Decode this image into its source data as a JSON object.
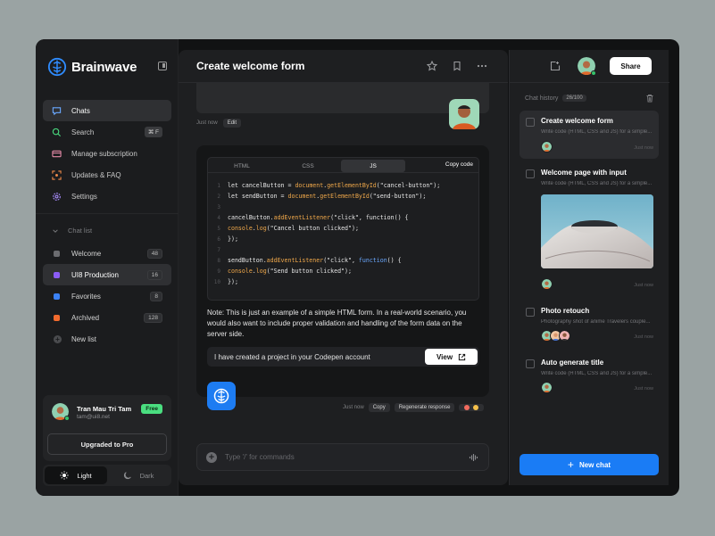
{
  "brand": {
    "name": "Brainwave",
    "accent": "#1a7cf5"
  },
  "nav": [
    {
      "label": "Chats",
      "icon": "chat-icon",
      "color": "#6aa8ff",
      "active": true
    },
    {
      "label": "Search",
      "icon": "search-icon",
      "color": "#4ade80",
      "shortcut": "⌘ F"
    },
    {
      "label": "Manage subscription",
      "icon": "card-icon",
      "color": "#e58aa8"
    },
    {
      "label": "Updates & FAQ",
      "icon": "scan-icon",
      "color": "#f08a4a"
    },
    {
      "label": "Settings",
      "icon": "gear-icon",
      "color": "#a78bfa"
    }
  ],
  "chat_list": {
    "heading": "Chat list",
    "folders": [
      {
        "label": "Welcome",
        "count": "48",
        "color": "#6b6c70"
      },
      {
        "label": "UI8 Production",
        "count": "16",
        "color": "#8b5cf6",
        "active": true
      },
      {
        "label": "Favorites",
        "count": "8",
        "color": "#3b82f6"
      },
      {
        "label": "Archived",
        "count": "128",
        "color": "#f26b2e"
      }
    ],
    "new_list": "New list"
  },
  "user": {
    "name": "Tran Mau Tri Tam",
    "email": "tam@ui8.net",
    "plan": "Free",
    "upgrade_label": "Upgraded to Pro"
  },
  "theme": {
    "light": "Light",
    "dark": "Dark"
  },
  "main": {
    "title": "Create welcome form",
    "prev_meta": {
      "time": "Just now",
      "edit": "Edit"
    },
    "code": {
      "tabs": [
        "HTML",
        "CSS",
        "JS"
      ],
      "active_tab": "JS",
      "copy_label": "Copy code",
      "lines": [
        {
          "n": "1",
          "text": "let cancelButton = document.getElementById(\"cancel-button\");"
        },
        {
          "n": "2",
          "text": "let sendButton = document.getElementById(\"send-button\");"
        },
        {
          "n": "3",
          "text": ""
        },
        {
          "n": "4",
          "text": "cancelButton.addEventListener(\"click\", function() {"
        },
        {
          "n": "5",
          "text": "console.log(\"Cancel button clicked\");"
        },
        {
          "n": "6",
          "text": "});"
        },
        {
          "n": "7",
          "text": ""
        },
        {
          "n": "8",
          "text": "sendButton.addEventListener(\"click\", function() {"
        },
        {
          "n": "9",
          "text": "console.log(\"Send button clicked\");"
        },
        {
          "n": "10",
          "text": "});"
        }
      ]
    },
    "note": "Note: This is just an example of a simple HTML form. In a real-world scenario, you would also want to include proper validation and handling of the form data on the server side.",
    "codepen": {
      "text": "I have created a project in your Codepen account",
      "view_label": "View"
    },
    "resp_meta": {
      "time": "Just now",
      "copy": "Copy",
      "regen": "Regenerate response"
    },
    "composer": {
      "placeholder": "Type '/' for commands"
    }
  },
  "right": {
    "share_label": "Share",
    "history_heading": "Chat history",
    "history_count": "26/100",
    "items": [
      {
        "title": "Create welcome form",
        "desc": "Write code (HTML, CSS and JS) for a simple...",
        "time": "Just now",
        "active": true
      },
      {
        "title": "Welcome page with input",
        "desc": "Write code (HTML, CSS and JS) for a simple...",
        "time": "Just now"
      },
      {
        "title": "Photo retouch",
        "desc": "Photography shot of anime Travelers couple...",
        "time": "Just now"
      },
      {
        "title": "Auto generate title",
        "desc": "Write code (HTML, CSS and JS) for a simple...",
        "time": "Just now"
      }
    ],
    "new_chat_label": "New chat"
  }
}
